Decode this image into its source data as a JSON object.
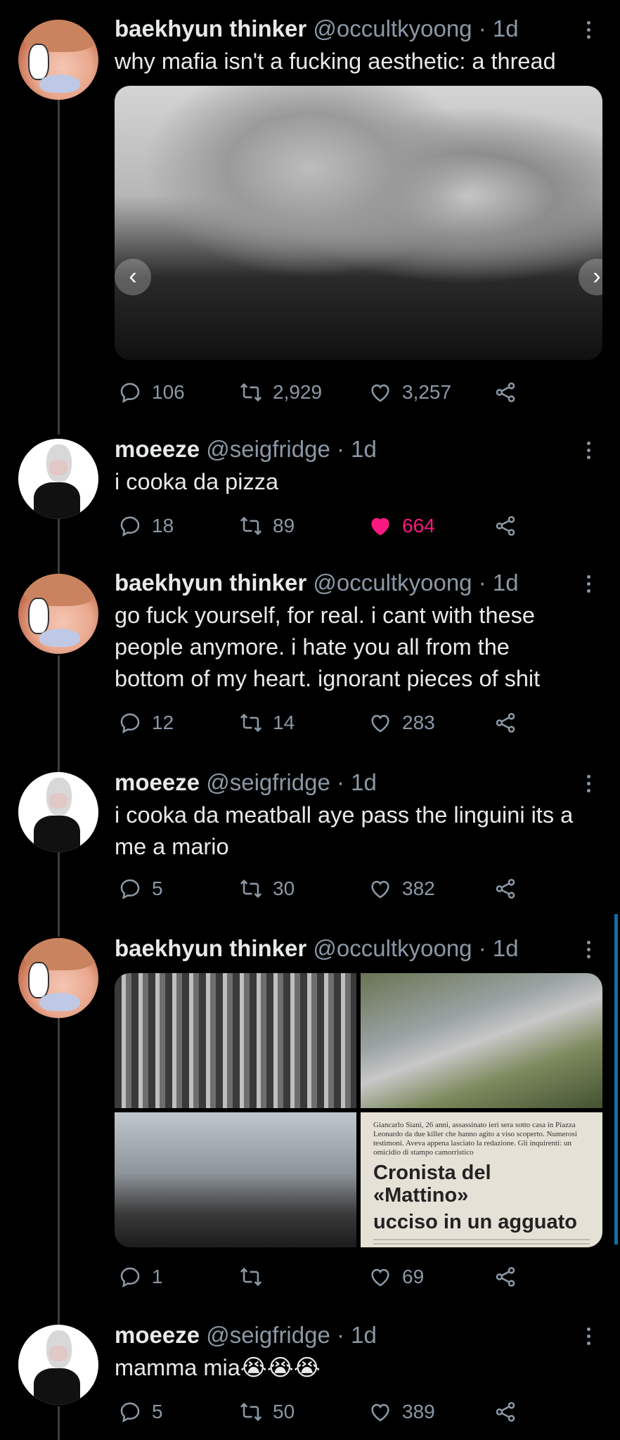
{
  "tweets": [
    {
      "name": "baekhyun thinker",
      "meta": "@occultkyoong · 1d",
      "text": "why mafia isn't a fucking aesthetic: a thread",
      "replies": "106",
      "retweets": "2,929",
      "likes": "3,257",
      "liked": false
    },
    {
      "name": "moeeze",
      "meta": "@seigfridge · 1d",
      "text": "i cooka da pizza",
      "replies": "18",
      "retweets": "89",
      "likes": "664",
      "liked": true
    },
    {
      "name": "baekhyun thinker",
      "meta": "@occultkyoong · 1d",
      "text_lines": [
        "go fuck yourself, for real. i cant with these",
        "people anymore. i hate you all from the",
        "bottom of my heart. ignorant pieces of shit"
      ],
      "replies": "12",
      "retweets": "14",
      "likes": "283",
      "liked": false
    },
    {
      "name": "moeeze",
      "meta": "@seigfridge · 1d",
      "text_lines": [
        "i cooka da meatball aye pass the linguini its a",
        "me a mario"
      ],
      "replies": "5",
      "retweets": "30",
      "likes": "382",
      "liked": false
    },
    {
      "name": "baekhyun thinker",
      "meta": "@occultkyoong · 1d",
      "replies": "1",
      "retweets": "",
      "likes": "69",
      "liked": false,
      "newspaper": {
        "small": "Giancarlo Siani, 26 anni, assassinato ieri sera sotto casa in Piazza Leonardo da due killer che hanno agito a viso scoperto. Numerosi testimoni. Aveva appena lasciato la redazione. Gli inquirenti: un omicidio di stampo camorristico",
        "headline_1": "Cronista del «Mattino»",
        "headline_2": "ucciso in un agguato"
      }
    },
    {
      "name": "moeeze",
      "meta": "@seigfridge · 1d",
      "text": "mamma mia😭😭😭",
      "replies": "5",
      "retweets": "50",
      "likes": "389",
      "liked": false
    }
  ],
  "icons": {
    "reply": "reply-icon",
    "retweet": "retweet-icon",
    "like": "heart-icon",
    "share": "share-icon",
    "more": "more-icon"
  },
  "colors": {
    "background": "#000000",
    "text": "#e7e9ea",
    "muted": "#8b98a5",
    "liked": "#f91880",
    "thread_line": "#3a3d40"
  }
}
